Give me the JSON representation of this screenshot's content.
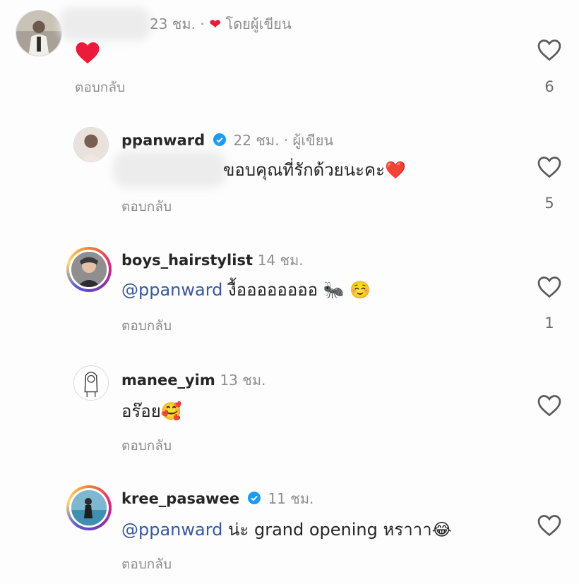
{
  "colors": {
    "heart": "#ed1b3b",
    "mention": "#385898",
    "meta": "#8e8e8e",
    "verified": "#1d9bf0"
  },
  "comments": [
    {
      "username": "",
      "time": "23 ชม. ·",
      "author_label": "โดยผู้เขียน",
      "text": "❤️",
      "reply": "ตอบกลับ",
      "likes": "6",
      "icon": "red-heart"
    },
    {
      "username": "ppanward",
      "time": "22 ชม. · ผู้เขียน",
      "text": "ขอบคุณที่รักด้วยนะคะ❤️",
      "reply": "ตอบกลับ",
      "likes": "5",
      "verified": true
    },
    {
      "username": "boys_hairstylist",
      "time": "14 ชม.",
      "mention": "@ppanward",
      "text": " งื้ออออออออ 🐜 ☺️",
      "reply": "ตอบกลับ",
      "likes": "1"
    },
    {
      "username": "manee_yim",
      "time": "13 ชม.",
      "text": "อร๊อย🥰",
      "reply": "ตอบกลับ",
      "likes": ""
    },
    {
      "username": "kree_pasawee",
      "time": "11 ชม.",
      "mention": "@ppanward",
      "text": " น่ะ grand opening หราาา😂",
      "reply": "ตอบกลับ",
      "likes": "",
      "verified": true
    }
  ]
}
